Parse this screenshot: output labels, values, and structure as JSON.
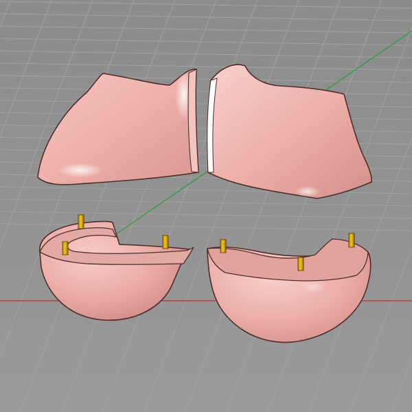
{
  "viewport": {
    "background_color": "#939393",
    "grid_line_color": "#a3a3a3",
    "x_axis_color": "#c0392b",
    "y_axis_color": "#3fa650"
  },
  "model": {
    "material_color": "#f0b5b0",
    "pin_color": "#d9a400",
    "pieces": [
      "upper-left-shell",
      "upper-right-shell",
      "lower-left-hemisphere",
      "lower-right-hemisphere"
    ]
  }
}
